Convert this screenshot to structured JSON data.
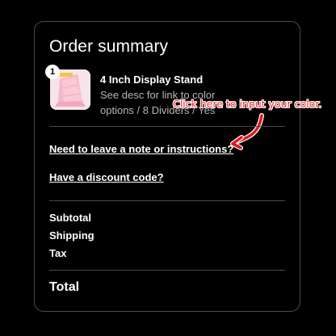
{
  "order_summary": {
    "title": "Order summary",
    "item": {
      "quantity": "1",
      "name": "4 Inch Display Stand",
      "description": "See desc for link to color options / 8 Dividers / Yes",
      "thumbnail_icon": "pink-display-stand-image"
    },
    "annotation": {
      "text": "Click here to input your color.",
      "color": "#ff2a2a",
      "arrow_icon": "curved-arrow-icon"
    },
    "note_link": "Need to leave a note or instructions?",
    "discount_link": "Have a discount code?",
    "subtotal_label": "Subtotal",
    "shipping_label": "Shipping",
    "tax_label": "Tax",
    "total_label": "Total"
  },
  "colors": {
    "background": "#000000",
    "panel_border": "#4a4a4a",
    "text": "#ffffff",
    "muted_text": "#b7b7b7",
    "thumbnail_bg": "#f7e4ea"
  }
}
